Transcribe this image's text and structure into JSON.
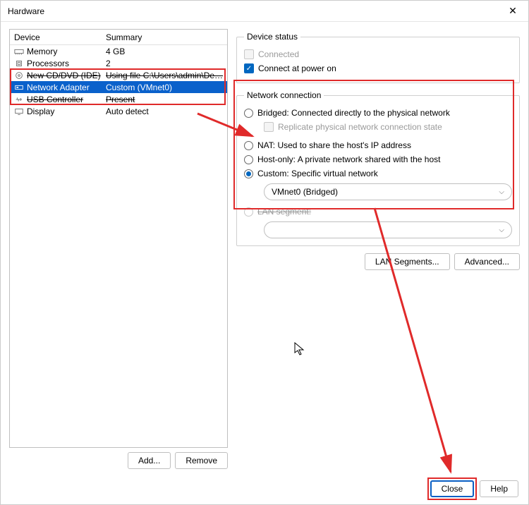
{
  "window": {
    "title": "Hardware"
  },
  "device_table": {
    "headers": {
      "device": "Device",
      "summary": "Summary"
    },
    "rows": [
      {
        "name": "Memory",
        "summary": "4 GB",
        "struck": false,
        "selected": false,
        "icon": "memory"
      },
      {
        "name": "Processors",
        "summary": "2",
        "struck": false,
        "selected": false,
        "icon": "cpu"
      },
      {
        "name": "New CD/DVD (IDE)",
        "summary": "Using file C:\\Users\\admin\\De…",
        "struck": true,
        "selected": false,
        "icon": "disc"
      },
      {
        "name": "Network Adapter",
        "summary": "Custom (VMnet0)",
        "struck": false,
        "selected": true,
        "icon": "net"
      },
      {
        "name": "USB Controller",
        "summary": "Present",
        "struck": true,
        "selected": false,
        "icon": "usb"
      },
      {
        "name": "Display",
        "summary": "Auto detect",
        "struck": false,
        "selected": false,
        "icon": "display"
      }
    ]
  },
  "left_buttons": {
    "add": "Add...",
    "remove": "Remove"
  },
  "device_status": {
    "legend": "Device status",
    "connected_label": "Connected",
    "connect_power_label": "Connect at power on"
  },
  "network": {
    "legend": "Network connection",
    "bridged": "Bridged: Connected directly to the physical network",
    "replicate": "Replicate physical network connection state",
    "nat": "NAT: Used to share the host's IP address",
    "hostonly": "Host-only: A private network shared with the host",
    "custom": "Custom: Specific virtual network",
    "custom_select": "VMnet0 (Bridged)",
    "lanseg": "LAN segment:",
    "lanseg_select": ""
  },
  "right_buttons": {
    "lanseg": "LAN Segments...",
    "advanced": "Advanced..."
  },
  "footer": {
    "close": "Close",
    "help": "Help"
  }
}
